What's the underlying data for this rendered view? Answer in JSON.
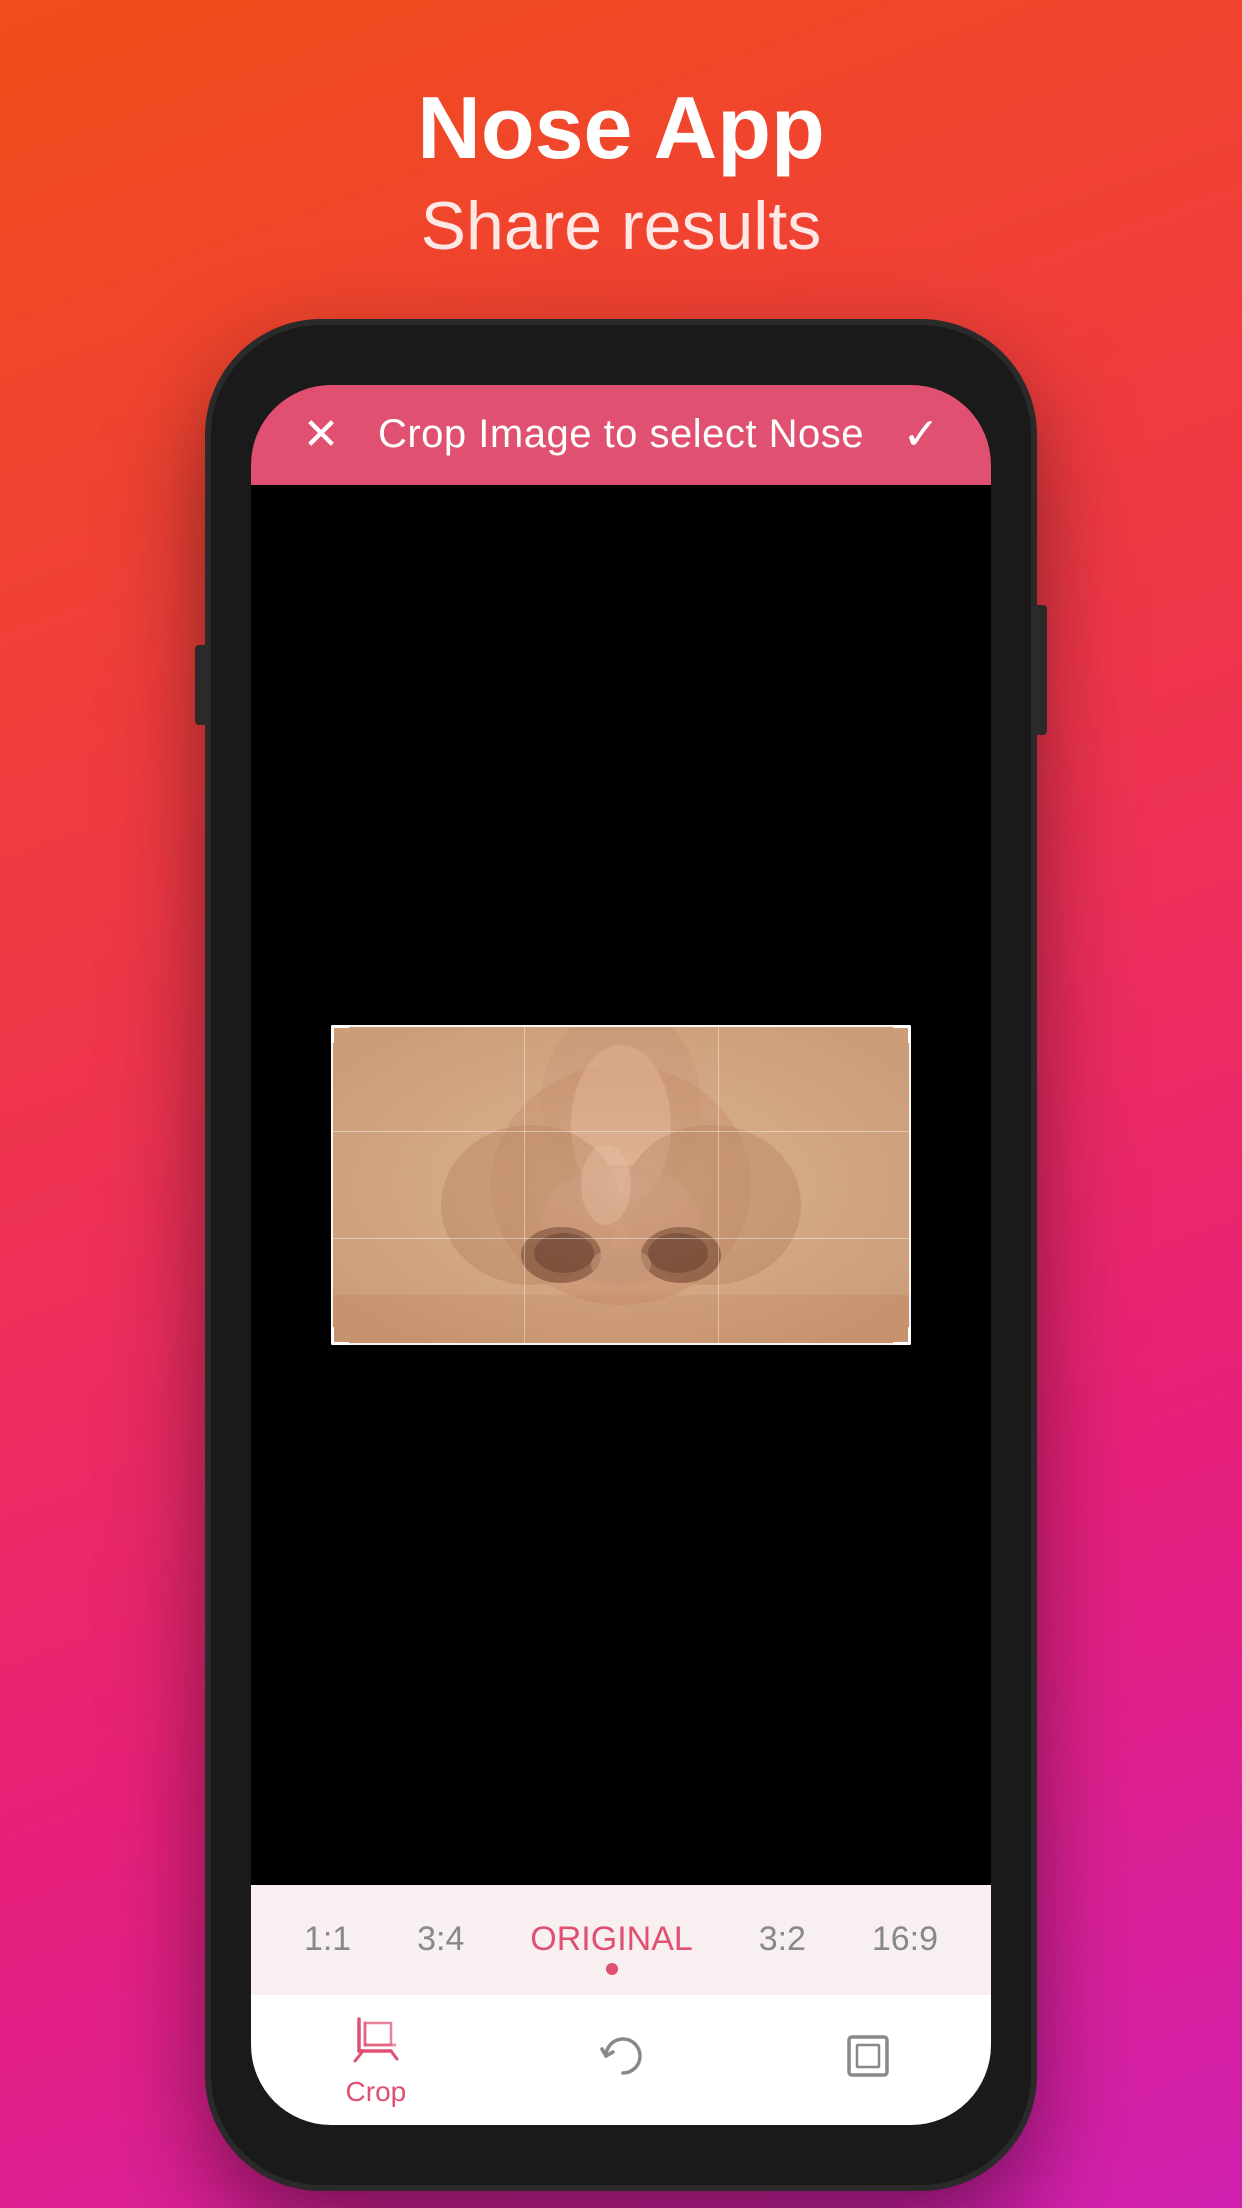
{
  "app": {
    "title": "Nose App",
    "subtitle": "Share results"
  },
  "crop_header": {
    "title": "Crop Image to select Nose",
    "close_label": "×",
    "confirm_label": "✓",
    "background_color": "#e05070"
  },
  "ratio_bar": {
    "options": [
      {
        "label": "1:1",
        "active": false
      },
      {
        "label": "3:4",
        "active": false
      },
      {
        "label": "ORIGINAL",
        "active": true
      },
      {
        "label": "3:2",
        "active": false
      },
      {
        "label": "16:9",
        "active": false
      }
    ]
  },
  "toolbar": {
    "items": [
      {
        "label": "Crop",
        "active": true,
        "icon": "crop-icon"
      },
      {
        "label": "",
        "active": false,
        "icon": "rotate-icon"
      },
      {
        "label": "",
        "active": false,
        "icon": "expand-icon"
      }
    ],
    "crop_label": "Crop"
  }
}
